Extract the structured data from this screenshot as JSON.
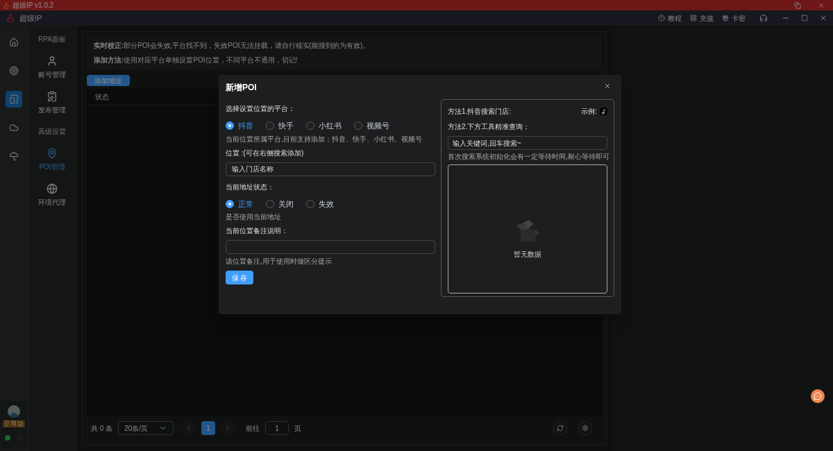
{
  "title_bar": {
    "title": "超级IP v1.0.2"
  },
  "header": {
    "app_name": "超级IP",
    "actions": [
      {
        "label": "教程"
      },
      {
        "label": "充值"
      },
      {
        "label": "卡密"
      }
    ]
  },
  "rail": [
    {
      "selected": false
    },
    {
      "selected": false
    },
    {
      "selected": true
    },
    {
      "selected": false
    },
    {
      "selected": false
    }
  ],
  "sidebar": [
    {
      "kind": "heading",
      "label": "RPA面板"
    },
    {
      "kind": "item",
      "label": "账号管理",
      "selected": false
    },
    {
      "kind": "item",
      "label": "发布管理",
      "selected": false
    },
    {
      "kind": "heading",
      "label": "高级设置"
    },
    {
      "kind": "item",
      "label": "POI管理",
      "selected": true
    },
    {
      "kind": "item",
      "label": "环境代理",
      "selected": false
    }
  ],
  "user": {
    "badge": "至尊版",
    "online": true
  },
  "notice": [
    {
      "label": "实时校正:",
      "text": "部分POI会失效,平台找不到，失效POI无法挂载，请自行核实(能搜到的为有效)。"
    },
    {
      "label": "添加方法:",
      "text": "使用对应平台单独设置POI位置，不同平台不通用，切记!"
    }
  ],
  "add_button": "添加地址",
  "table": {
    "columns": [
      "状态"
    ]
  },
  "pagination": {
    "total": "共 0 条",
    "page_size": "20条/页",
    "pages": [
      {
        "label": "1",
        "selected": true
      }
    ],
    "goto_label": "前往",
    "goto_value": "1",
    "goto_suffix": "页"
  },
  "dialog": {
    "title": "新增POI",
    "platform_label": "选择设置位置的平台：",
    "platforms": [
      {
        "label": "抖音",
        "selected": true
      },
      {
        "label": "快手",
        "selected": false
      },
      {
        "label": "小红书",
        "selected": false
      },
      {
        "label": "视频号",
        "selected": false
      }
    ],
    "platform_hint": "当前位置所属平台,目前支持添加：抖音、快手、小红书、视频号",
    "location_label": "位置 :(可在右侧搜索添加)",
    "location_placeholder": "输入门店名称",
    "status_label": "当前地址状态：",
    "statuses": [
      {
        "label": "正常",
        "selected": true
      },
      {
        "label": "关闭",
        "selected": false
      },
      {
        "label": "失效",
        "selected": false
      }
    ],
    "status_hint": "是否使用当前地址",
    "note_label": "当前位置备注说明：",
    "note_hint": "该位置备注,用于使用时做区分提示",
    "save": "保 存",
    "search_panel": {
      "method1": "方法1.抖音搜索门店:",
      "example": "示例:",
      "method2": "方法2.下方工具精准查询：",
      "search_placeholder": "输入关键词,回车搜索~",
      "search_hint": "首次搜索系统初始化会有一定等待时间,耐心等待即可",
      "empty": "暂无数据"
    }
  }
}
